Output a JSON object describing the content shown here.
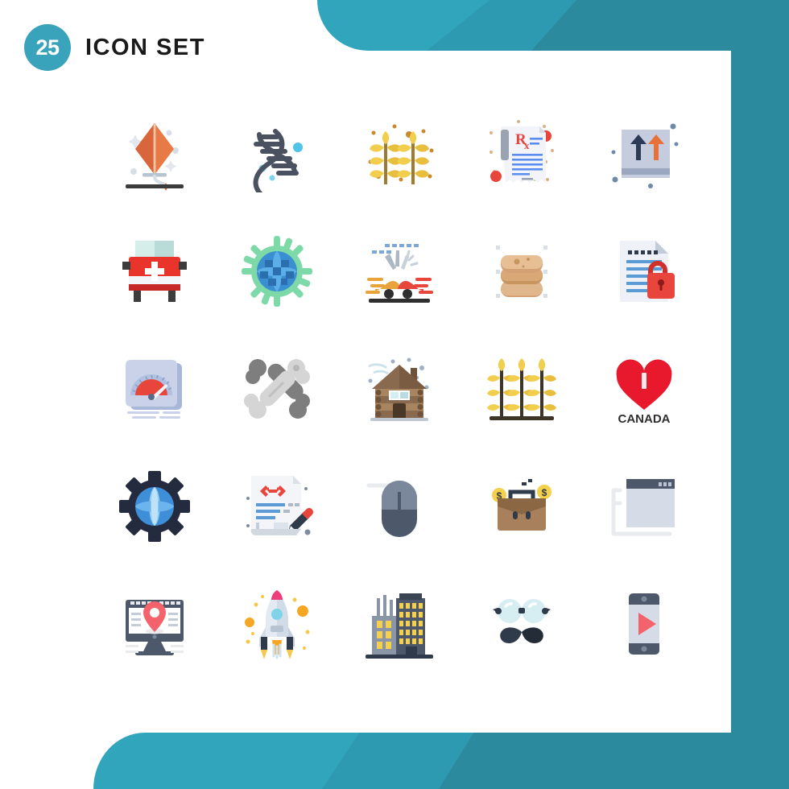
{
  "header": {
    "count": "25",
    "title": "ICON SET",
    "badge_color": "#3AA3BC",
    "title_color": "#1a1a1a"
  },
  "theme": {
    "teal_light": "#31A5BC",
    "teal_mid": "#2D9AB1",
    "teal_dark": "#2B8A9E",
    "panel_bg": "#ffffff"
  },
  "grid": {
    "columns": 5,
    "rows": 5,
    "total_icons": 25
  },
  "icons": [
    {
      "index": 1,
      "name": "kite-icon",
      "label": "Kite",
      "row": 1,
      "col": 1,
      "colors": [
        "#E8703A",
        "#CFD8DC",
        "#3E3E3E"
      ]
    },
    {
      "index": 2,
      "name": "dna-icon",
      "label": "DNA",
      "row": 1,
      "col": 2,
      "colors": [
        "#4A5160",
        "#7ECBE8",
        "#29ABE2"
      ]
    },
    {
      "index": 3,
      "name": "wheat-crops-icon",
      "label": "Wheat Crops",
      "row": 1,
      "col": 3,
      "colors": [
        "#F5CE4A",
        "#E8B93C",
        "#8A6A2F"
      ]
    },
    {
      "index": 4,
      "name": "prescription-rx-icon",
      "label": "Prescription",
      "row": 1,
      "col": 4,
      "colors": [
        "#F4F5FA",
        "#5B8DEF",
        "#E8453C",
        "#8BC34A"
      ]
    },
    {
      "index": 5,
      "name": "this-side-up-box-icon",
      "label": "This Side Up Box",
      "row": 1,
      "col": 5,
      "colors": [
        "#C7CFE2",
        "#2B3A55",
        "#E8703A"
      ]
    },
    {
      "index": 6,
      "name": "ambulance-icon",
      "label": "Ambulance",
      "row": 2,
      "col": 1,
      "colors": [
        "#E8342B",
        "#C62828",
        "#D4EFEA",
        "#3E3E3E"
      ]
    },
    {
      "index": 7,
      "name": "virus-globe-icon",
      "label": "Virus",
      "row": 2,
      "col": 2,
      "colors": [
        "#7ED9A8",
        "#2E7BBF",
        "#1F5FA0"
      ]
    },
    {
      "index": 8,
      "name": "car-accident-icon",
      "label": "Car Accident",
      "row": 2,
      "col": 3,
      "colors": [
        "#E8A33A",
        "#E8453C",
        "#9AA5B1",
        "#2F2F2F"
      ]
    },
    {
      "index": 9,
      "name": "pancakes-stack-icon",
      "label": "Pancakes",
      "row": 2,
      "col": 4,
      "colors": [
        "#E5B98C",
        "#D4A373",
        "#C08E5C"
      ]
    },
    {
      "index": 10,
      "name": "secure-document-icon",
      "label": "Secure Document",
      "row": 2,
      "col": 5,
      "colors": [
        "#EDF1F7",
        "#5B9BD5",
        "#E8453C"
      ]
    },
    {
      "index": 11,
      "name": "speedometer-icon",
      "label": "Speedometer",
      "row": 3,
      "col": 1,
      "colors": [
        "#C7D0E8",
        "#E8453C",
        "#A8B6D8"
      ]
    },
    {
      "index": 12,
      "name": "crossed-bones-icon",
      "label": "Bones",
      "row": 3,
      "col": 2,
      "colors": [
        "#7E7E7E",
        "#D5D5D5",
        "#B5B5B5"
      ]
    },
    {
      "index": 13,
      "name": "log-cabin-icon",
      "label": "Log Cabin",
      "row": 3,
      "col": 3,
      "colors": [
        "#8A6A4E",
        "#6E5339",
        "#D6EEF2"
      ]
    },
    {
      "index": 14,
      "name": "wheat-field-icon",
      "label": "Wheat Field",
      "row": 3,
      "col": 4,
      "colors": [
        "#F5CE4A",
        "#E8B93C",
        "#3E3428"
      ]
    },
    {
      "index": 15,
      "name": "i-love-canada-icon",
      "label": "I Love Canada",
      "row": 3,
      "col": 5,
      "text": "CANADA",
      "colors": [
        "#E8192C",
        "#2F2F2F"
      ]
    },
    {
      "index": 16,
      "name": "global-settings-icon",
      "label": "Global Settings",
      "row": 4,
      "col": 1,
      "colors": [
        "#252B3F",
        "#4FA3E8",
        "#8FCBF5"
      ]
    },
    {
      "index": 17,
      "name": "code-editing-icon",
      "label": "Code Editing",
      "row": 4,
      "col": 2,
      "colors": [
        "#F4F5F8",
        "#5B9BD5",
        "#E8453C",
        "#2F3A4A"
      ]
    },
    {
      "index": 18,
      "name": "computer-mouse-icon",
      "label": "Computer Mouse",
      "row": 4,
      "col": 3,
      "colors": [
        "#4D596B",
        "#7B879B",
        "#E9EBEF"
      ]
    },
    {
      "index": 19,
      "name": "business-briefcase-icon",
      "label": "Business Briefcase",
      "row": 4,
      "col": 4,
      "colors": [
        "#A8805C",
        "#8C6744",
        "#F5D04A",
        "#2F3A4A"
      ]
    },
    {
      "index": 20,
      "name": "browser-window-icon",
      "label": "Browser Window",
      "row": 4,
      "col": 5,
      "colors": [
        "#4D596B",
        "#D5DCE8",
        "#E9EBEF"
      ]
    },
    {
      "index": 21,
      "name": "location-desktop-icon",
      "label": "Location Desktop",
      "row": 5,
      "col": 1,
      "colors": [
        "#4D596B",
        "#F4626B",
        "#E9EBEF"
      ]
    },
    {
      "index": 22,
      "name": "rocket-launch-icon",
      "label": "Rocket Launch",
      "row": 5,
      "col": 2,
      "colors": [
        "#DCE6F0",
        "#EE3E7A",
        "#F5A623",
        "#7FD4E8"
      ]
    },
    {
      "index": 23,
      "name": "city-buildings-icon",
      "label": "City Buildings",
      "row": 5,
      "col": 3,
      "colors": [
        "#4D596B",
        "#8A95A5",
        "#F5D04A"
      ]
    },
    {
      "index": 24,
      "name": "hipster-glasses-icon",
      "label": "Hipster Glasses",
      "row": 5,
      "col": 4,
      "colors": [
        "#D6EEF2",
        "#2F3A4A"
      ]
    },
    {
      "index": 25,
      "name": "mobile-video-icon",
      "label": "Mobile Video",
      "row": 5,
      "col": 5,
      "colors": [
        "#4D596B",
        "#D5DCE8",
        "#F4626B"
      ]
    }
  ]
}
